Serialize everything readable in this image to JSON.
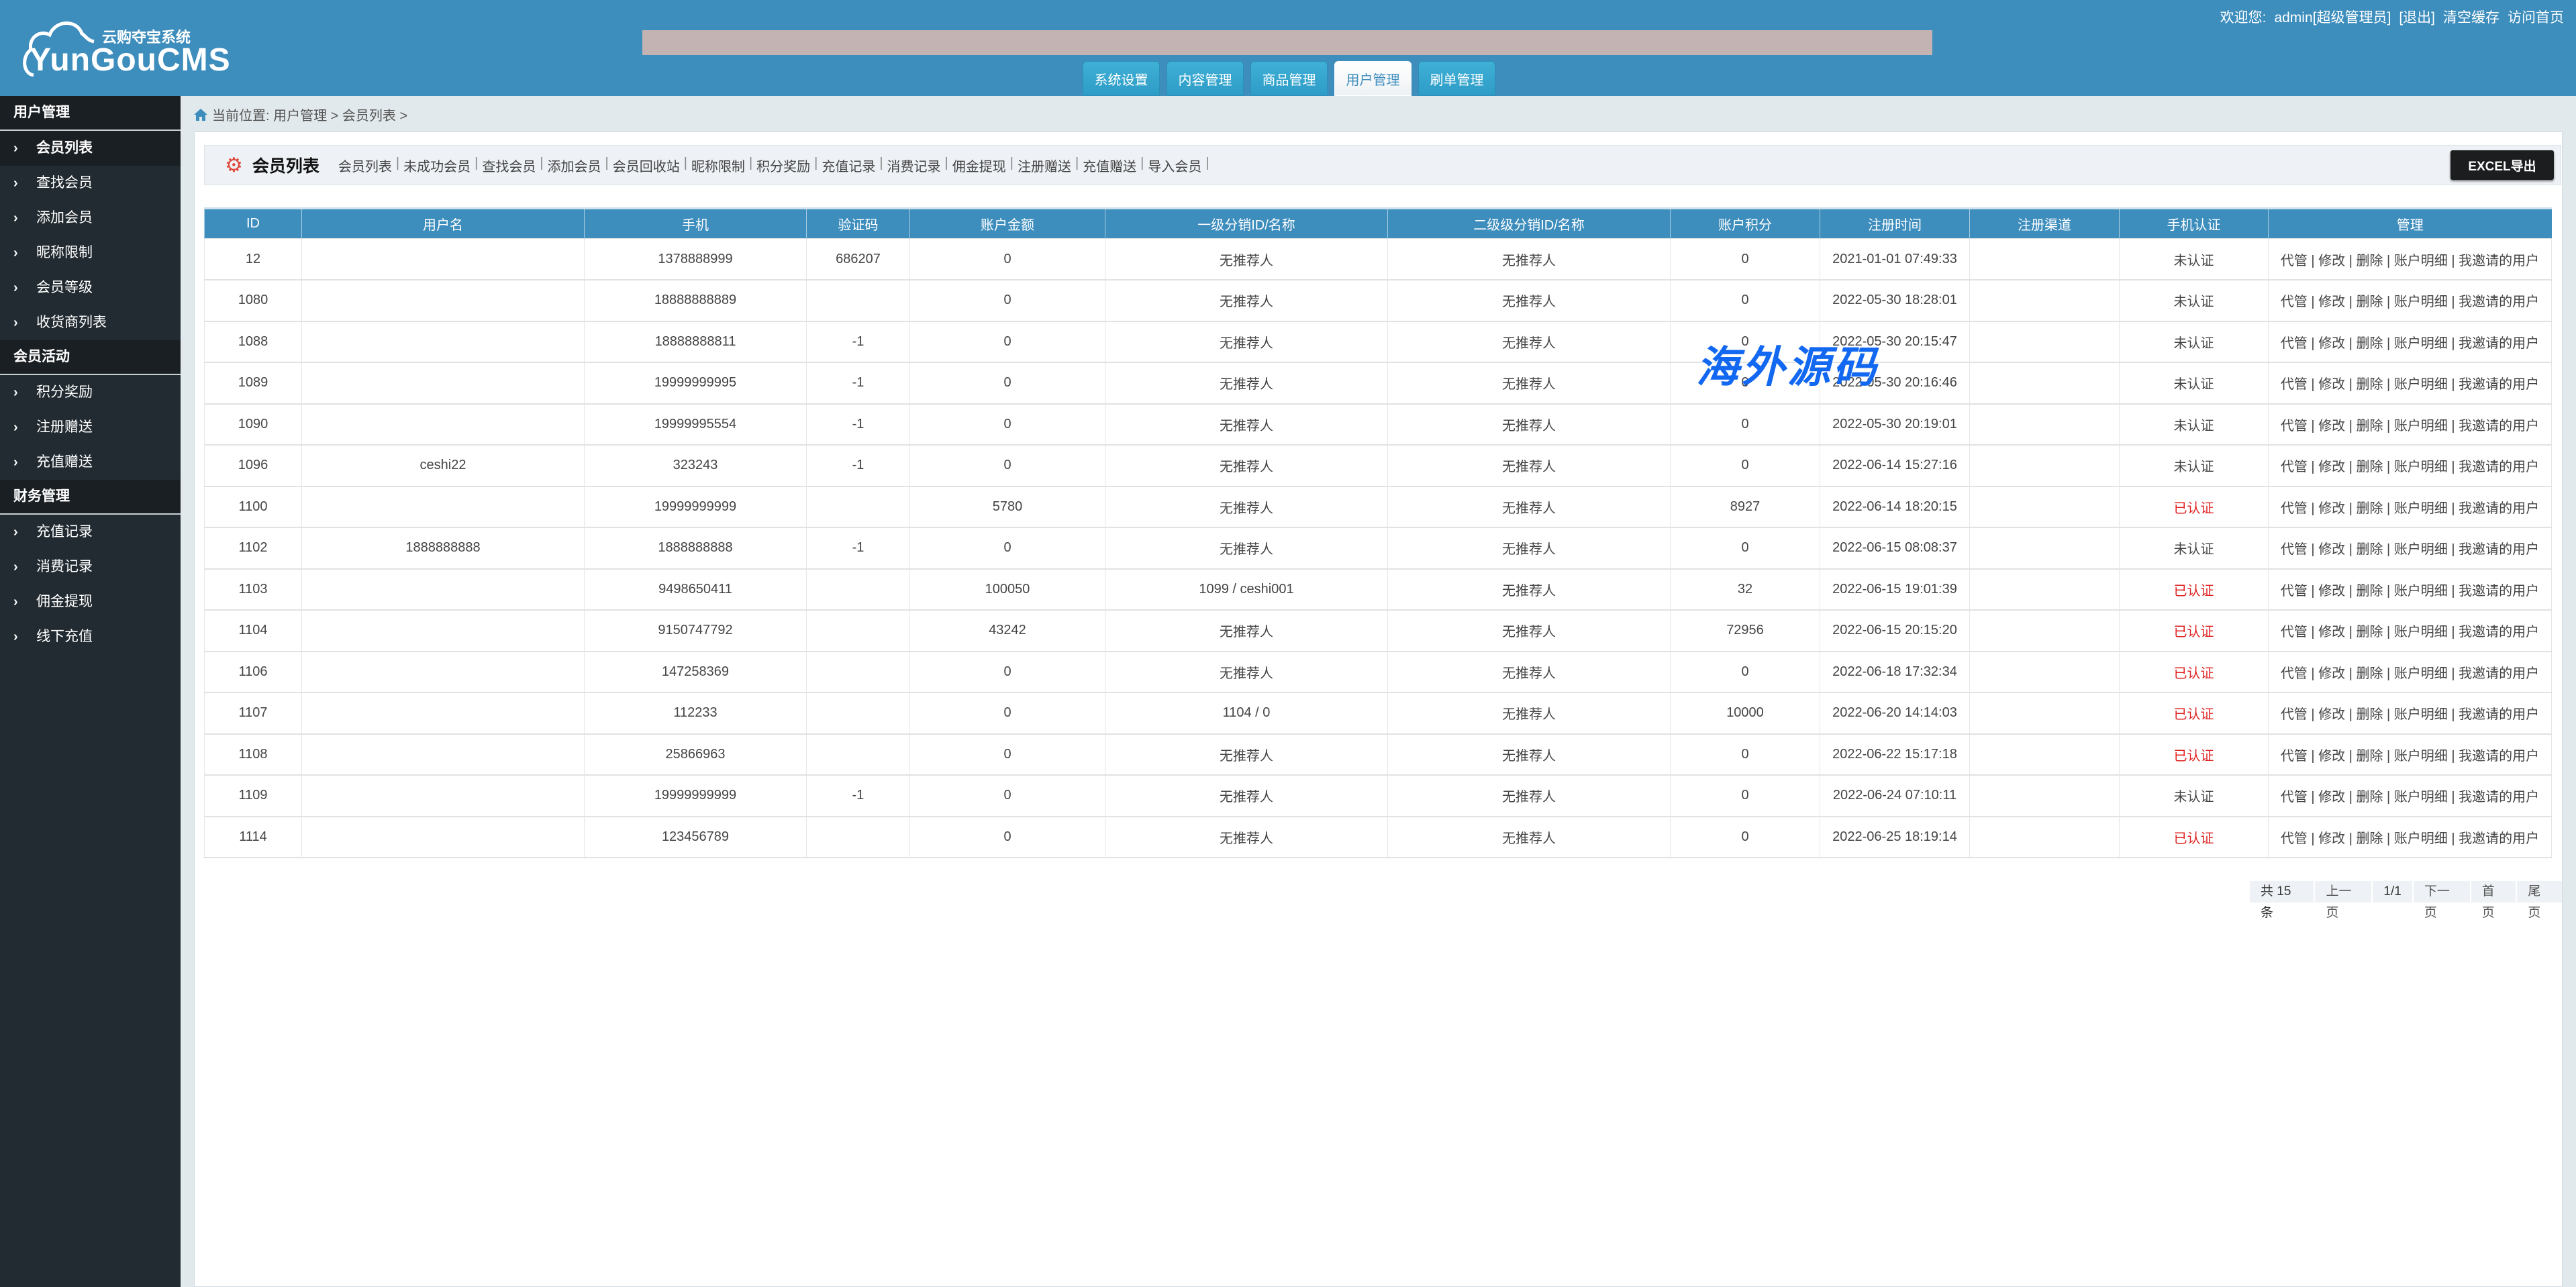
{
  "logo": {
    "subtitle": "云购夺宝系统",
    "name": "YunGouCMS"
  },
  "top_links": {
    "welcome": "欢迎您:",
    "user": "admin[超级管理员]",
    "logout": "[退出]",
    "clear_cache": "清空缓存",
    "visit_home": "访问首页"
  },
  "nav_tabs": [
    {
      "label": "系统设置",
      "active": false
    },
    {
      "label": "内容管理",
      "active": false
    },
    {
      "label": "商品管理",
      "active": false
    },
    {
      "label": "用户管理",
      "active": true
    },
    {
      "label": "刷单管理",
      "active": false
    }
  ],
  "sidebar": {
    "sections": [
      {
        "title": "用户管理",
        "items": [
          "会员列表",
          "查找会员",
          "添加会员",
          "昵称限制",
          "会员等级",
          "收货商列表"
        ]
      },
      {
        "title": "会员活动",
        "items": [
          "积分奖励",
          "注册赠送",
          "充值赠送"
        ]
      },
      {
        "title": "财务管理",
        "items": [
          "充值记录",
          "消费记录",
          "佣金提现",
          "线下充值"
        ]
      }
    ],
    "active_item": "会员列表"
  },
  "breadcrumb": "当前位置: 用户管理 > 会员列表 >",
  "page_title": "会员列表",
  "sub_links": [
    "会员列表",
    "未成功会员",
    "查找会员",
    "添加会员",
    "会员回收站",
    "昵称限制",
    "积分奖励",
    "充值记录",
    "消费记录",
    "佣金提现",
    "注册赠送",
    "充值赠送",
    "导入会员"
  ],
  "excel_button": "EXCEL导出",
  "table": {
    "columns": [
      "ID",
      "用户名",
      "手机",
      "验证码",
      "账户金额",
      "一级分销ID/名称",
      "二级级分销ID/名称",
      "账户积分",
      "注册时间",
      "注册渠道",
      "手机认证",
      "管理"
    ],
    "actions": [
      "代管",
      "修改",
      "删除",
      "账户明细",
      "我邀请的用户"
    ],
    "rows": [
      [
        "12",
        "",
        "1378888999",
        "686207",
        "0",
        "无推荐人",
        "无推荐人",
        "0",
        "2021-01-01 07:49:33",
        "",
        "未认证"
      ],
      [
        "1080",
        "",
        "18888888889",
        "",
        "0",
        "无推荐人",
        "无推荐人",
        "0",
        "2022-05-30 18:28:01",
        "",
        "未认证"
      ],
      [
        "1088",
        "",
        "18888888811",
        "-1",
        "0",
        "无推荐人",
        "无推荐人",
        "0",
        "2022-05-30 20:15:47",
        "",
        "未认证"
      ],
      [
        "1089",
        "",
        "19999999995",
        "-1",
        "0",
        "无推荐人",
        "无推荐人",
        "0",
        "2022-05-30 20:16:46",
        "",
        "未认证"
      ],
      [
        "1090",
        "",
        "19999995554",
        "-1",
        "0",
        "无推荐人",
        "无推荐人",
        "0",
        "2022-05-30 20:19:01",
        "",
        "未认证"
      ],
      [
        "1096",
        "ceshi22",
        "323243",
        "-1",
        "0",
        "无推荐人",
        "无推荐人",
        "0",
        "2022-06-14 15:27:16",
        "",
        "未认证"
      ],
      [
        "1100",
        "",
        "19999999999",
        "",
        "5780",
        "无推荐人",
        "无推荐人",
        "8927",
        "2022-06-14 18:20:15",
        "",
        "已认证"
      ],
      [
        "1102",
        "1888888888",
        "1888888888",
        "-1",
        "0",
        "无推荐人",
        "无推荐人",
        "0",
        "2022-06-15 08:08:37",
        "",
        "未认证"
      ],
      [
        "1103",
        "",
        "9498650411",
        "",
        "100050",
        "1099 / ceshi001",
        "无推荐人",
        "32",
        "2022-06-15 19:01:39",
        "",
        "已认证"
      ],
      [
        "1104",
        "",
        "9150747792",
        "",
        "43242",
        "无推荐人",
        "无推荐人",
        "72956",
        "2022-06-15 20:15:20",
        "",
        "已认证"
      ],
      [
        "1106",
        "",
        "147258369",
        "",
        "0",
        "无推荐人",
        "无推荐人",
        "0",
        "2022-06-18 17:32:34",
        "",
        "已认证"
      ],
      [
        "1107",
        "",
        "112233",
        "",
        "0",
        "1104 / 0",
        "无推荐人",
        "10000",
        "2022-06-20 14:14:03",
        "",
        "已认证"
      ],
      [
        "1108",
        "",
        "25866963",
        "",
        "0",
        "无推荐人",
        "无推荐人",
        "0",
        "2022-06-22 15:17:18",
        "",
        "已认证"
      ],
      [
        "1109",
        "",
        "19999999999",
        "-1",
        "0",
        "无推荐人",
        "无推荐人",
        "0",
        "2022-06-24 07:10:11",
        "",
        "未认证"
      ],
      [
        "1114",
        "",
        "123456789",
        "",
        "0",
        "无推荐人",
        "无推荐人",
        "0",
        "2022-06-25 18:19:14",
        "",
        "已认证"
      ]
    ],
    "verified_label": "已认证",
    "verified_color": "#e02020"
  },
  "pagination": {
    "total": "共 15 条",
    "prev": "上一页",
    "current": "1/1",
    "next": "下一页",
    "first": "首页",
    "last": "尾页"
  },
  "watermark": "海外源码",
  "colors": {
    "header": "#3d8dbd",
    "sidebar": "#222b31",
    "excel_button": "#1c1d1f"
  }
}
